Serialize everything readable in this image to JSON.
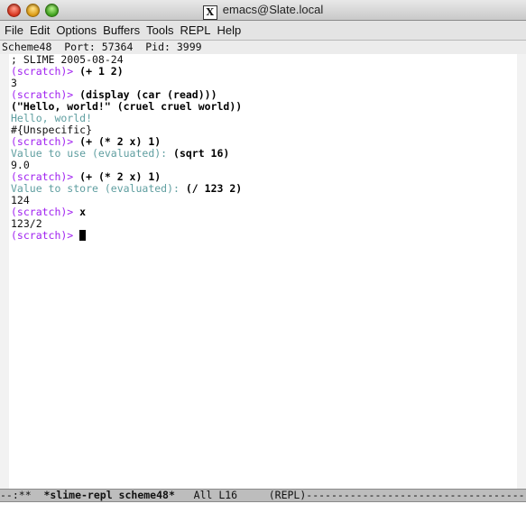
{
  "window": {
    "title": "emacs@Slate.local",
    "x_icon_glyph": "X"
  },
  "menu": [
    "File",
    "Edit",
    "Options",
    "Buffers",
    "Tools",
    "REPL",
    "Help"
  ],
  "header_line": "Scheme48  Port: 57364  Pid: 3999",
  "buffer_lines": [
    {
      "segments": [
        {
          "type": "plain",
          "text": "; SLIME 2005-08-24"
        }
      ]
    },
    {
      "segments": [
        {
          "type": "prompt",
          "text": "(scratch)> "
        },
        {
          "type": "input",
          "text": "(+ 1 2)"
        }
      ]
    },
    {
      "segments": [
        {
          "type": "plain",
          "text": "3"
        }
      ]
    },
    {
      "segments": [
        {
          "type": "prompt",
          "text": "(scratch)> "
        },
        {
          "type": "input",
          "text": "(display (car (read)))"
        }
      ]
    },
    {
      "segments": [
        {
          "type": "input",
          "text": "(\"Hello, world!\" (cruel cruel world))"
        }
      ]
    },
    {
      "segments": [
        {
          "type": "output",
          "text": "Hello, world!"
        }
      ]
    },
    {
      "segments": [
        {
          "type": "plain",
          "text": "#{Unspecific}"
        }
      ]
    },
    {
      "segments": [
        {
          "type": "prompt",
          "text": "(scratch)> "
        },
        {
          "type": "input",
          "text": "(+ (* 2 x) 1)"
        }
      ]
    },
    {
      "segments": [
        {
          "type": "output",
          "text": "Value to use (evaluated): "
        },
        {
          "type": "input",
          "text": "(sqrt 16)"
        }
      ]
    },
    {
      "segments": [
        {
          "type": "plain",
          "text": "9.0"
        }
      ]
    },
    {
      "segments": [
        {
          "type": "prompt",
          "text": "(scratch)> "
        },
        {
          "type": "input",
          "text": "(+ (* 2 x) 1)"
        }
      ]
    },
    {
      "segments": [
        {
          "type": "output",
          "text": "Value to store (evaluated): "
        },
        {
          "type": "input",
          "text": "(/ 123 2)"
        }
      ]
    },
    {
      "segments": [
        {
          "type": "plain",
          "text": "124"
        }
      ]
    },
    {
      "segments": [
        {
          "type": "prompt",
          "text": "(scratch)> "
        },
        {
          "type": "input",
          "text": "x"
        }
      ]
    },
    {
      "segments": [
        {
          "type": "plain",
          "text": "123/2"
        }
      ]
    },
    {
      "segments": [
        {
          "type": "prompt",
          "text": "(scratch)> "
        },
        {
          "type": "cursor",
          "text": ""
        }
      ]
    }
  ],
  "mode_line": {
    "prefix": "--:**  ",
    "buffer_name": "*slime-repl scheme48*",
    "position": "   All L16     ",
    "mode": "(REPL)",
    "fill": "------------------------------------------------"
  },
  "colors": {
    "prompt": "#a020f0",
    "output": "#5f9ea0",
    "modeline_bg": "#bdbdbd"
  }
}
